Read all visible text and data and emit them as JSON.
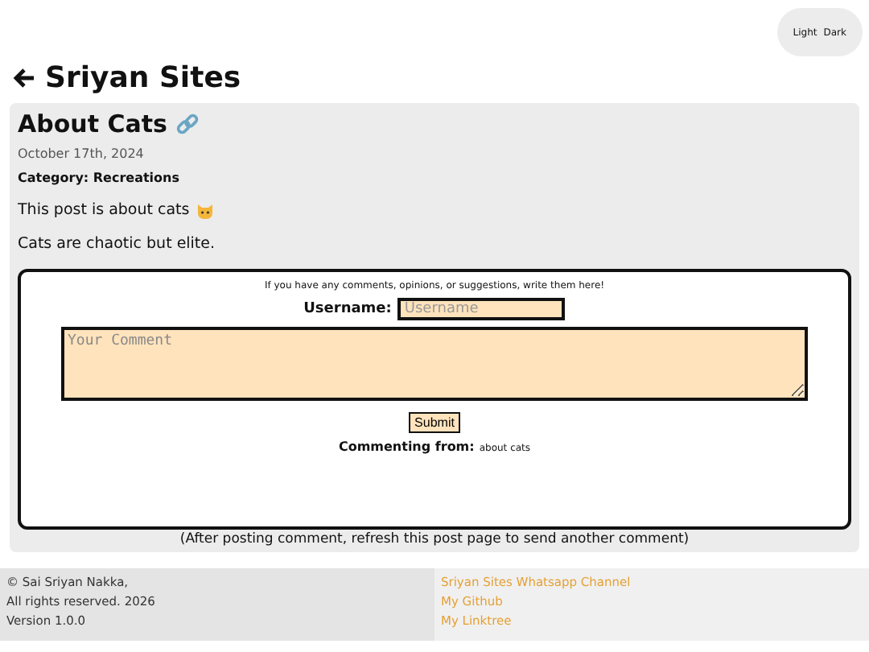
{
  "theme_toggle": {
    "options": [
      "Light",
      "Dark"
    ]
  },
  "header": {
    "title": "Sriyan Sites"
  },
  "post": {
    "title": "About Cats",
    "date": "October 17th, 2024",
    "category": "Category: Recreations",
    "paragraphs": [
      "This post is about cats",
      "Cats are chaotic but elite."
    ]
  },
  "comment_form": {
    "intro": "If you have any comments, opinions, or suggestions, write them here!",
    "username_label": "Username:",
    "username_placeholder": "Username",
    "comment_placeholder": "Your Comment",
    "submit": "Submit",
    "from_label": "Commenting from:",
    "from_value": "about cats"
  },
  "note": "(After posting comment, refresh this post page to send another comment)",
  "footer": {
    "lines": [
      "© Sai Sriyan Nakka,",
      "All rights reserved. 2026",
      "Version 1.0.0"
    ],
    "links": [
      "Sriyan Sites Whatsapp Channel",
      "My Github",
      "My Linktree"
    ]
  }
}
